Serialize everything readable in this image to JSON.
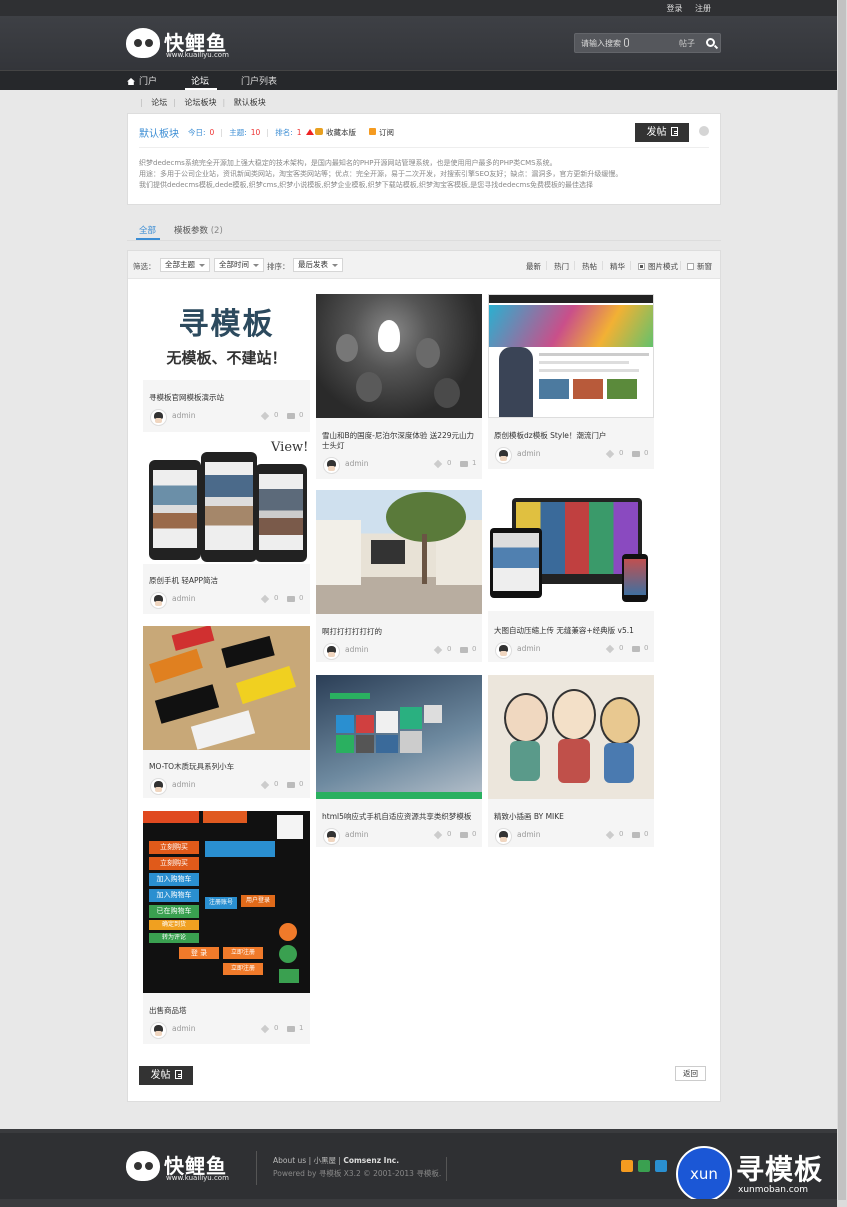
{
  "top_links": {
    "login": "登录",
    "register": "注册"
  },
  "logo": {
    "title": "快鲤鱼",
    "sub": "www.kuailiyu.com"
  },
  "search": {
    "placeholder": "请输入搜索",
    "type": "帖子"
  },
  "nav": {
    "items": [
      "门户",
      "论坛",
      "门户列表"
    ],
    "active": "论坛"
  },
  "breadcrumb": [
    "论坛",
    "论坛板块",
    "默认板块"
  ],
  "forum": {
    "name": "默认板块",
    "today_label": "今日:",
    "today": "0",
    "topics_label": "主题:",
    "topics": "10",
    "rank_label": "排名:",
    "rank": "1",
    "favorite": "收藏本版",
    "subscribe": "订阅",
    "post_button": "发帖",
    "description": [
      "织梦dedecms系统完全开源加上强大稳定的技术架构，是国内最知名的PHP开源网站管理系统，也是使用用户最多的PHP类CMS系统。",
      "用途：多用于公司企业站，资讯新闻类网站，淘宝客类网站等；优点：完全开源，易于二次开发，对搜索引擎SEO友好；缺点：漏洞多，官方更新升级缓慢。",
      "我们提供dedecms模板,dede模板,织梦cms,织梦小说模板,织梦企业模板,织梦下载站模板,织梦淘宝客模板,是您寻找dedecms免费模板的最佳选择"
    ]
  },
  "tabs": {
    "all": "全部",
    "param": "模板参数",
    "param_count": "(2)"
  },
  "filter": {
    "label": "筛选：",
    "theme": "全部主题",
    "time": "全部时间",
    "sort_label": "排序：",
    "sort": "最后发表",
    "latest": "最新",
    "hot": "热门",
    "hotpost": "热帖",
    "digest": "精华",
    "image_mode": "图片模式",
    "new_window": "新窗"
  },
  "cards": [
    {
      "title": "寻模板官网模板演示站",
      "author": "admin",
      "likes": "0",
      "replies": "0",
      "promo_title": "寻模板",
      "promo_sub": "无模板、不建站！"
    },
    {
      "title": "雪山和B的国度-尼泊尔深度体验 送229元山力士头灯",
      "author": "admin",
      "likes": "0",
      "replies": "1"
    },
    {
      "title": "原创模板dz模板 Style！潮流门户",
      "author": "admin",
      "likes": "0",
      "replies": "0"
    },
    {
      "title": "原创手机 轻APP简洁",
      "author": "admin",
      "likes": "0",
      "replies": "0",
      "overlay": "View!"
    },
    {
      "title": "啊打打打打打打的",
      "author": "admin",
      "likes": "0",
      "replies": "0"
    },
    {
      "title": "大图自动压缩上传 无缝兼容+经典版 v5.1",
      "author": "admin",
      "likes": "0",
      "replies": "0"
    },
    {
      "title": "MO-TO木质玩具系列小车",
      "author": "admin",
      "likes": "0",
      "replies": "0"
    },
    {
      "title": "html5响应式手机自适应资源共享类织梦模板",
      "author": "admin",
      "likes": "0",
      "replies": "0"
    },
    {
      "title": "精致小插画 BY MIKE",
      "author": "admin",
      "likes": "0",
      "replies": "0"
    },
    {
      "title": "出售商品塔",
      "author": "admin",
      "likes": "0",
      "replies": "1",
      "btn_labels": [
        "立刻购买",
        "立刻购买",
        "加入购物车",
        "加入购物车",
        "已在购物车",
        "确定到货",
        "转为评论",
        "注册账号",
        "用户登录",
        "立即注册",
        "登 录",
        "立即注册"
      ]
    }
  ],
  "bottom": {
    "post_button": "发帖",
    "back": "返回"
  },
  "footer": {
    "about": "About us",
    "xiaoheiwu": "小黑屋",
    "company": "Comsenz Inc.",
    "powered": "Powered by 寻模板 X3.2 © 2001-2013 寻模板."
  },
  "watermark": {
    "circle": "xun",
    "text": "寻模板",
    "url": "xunmoban.com"
  },
  "colors": {
    "accent": "#3b8dd4",
    "dark": "#333333",
    "stat_num": "#ee3333"
  }
}
